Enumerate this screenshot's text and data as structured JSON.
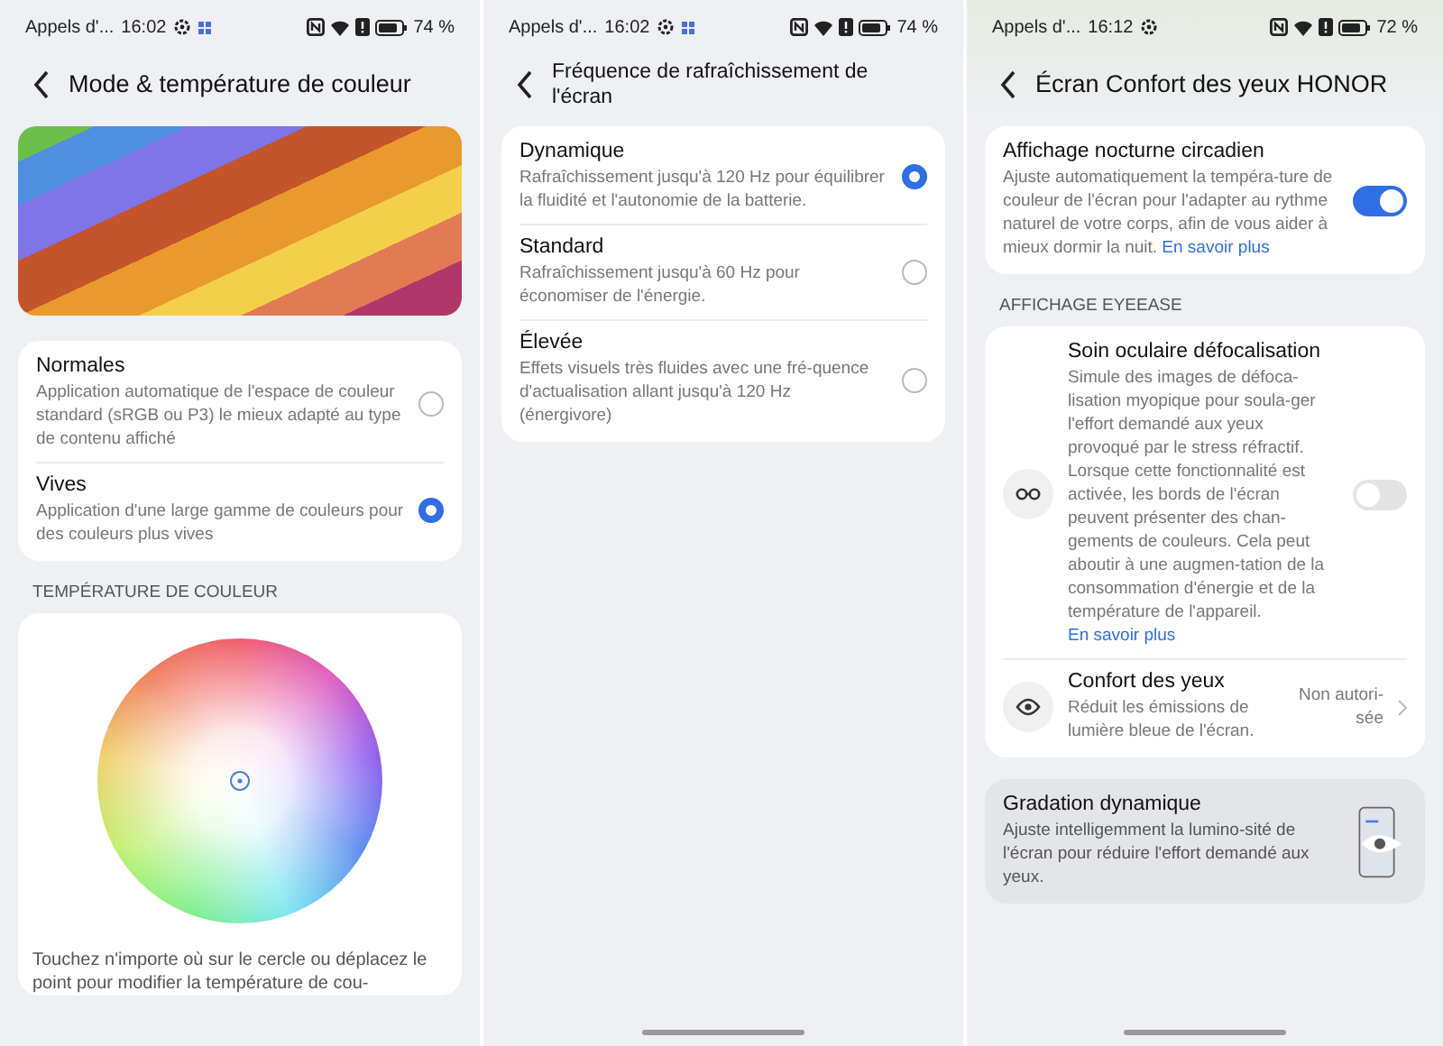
{
  "screens": [
    {
      "status": {
        "carrier": "Appels d'...",
        "time": "16:02",
        "battery": "74 %",
        "notification": true
      },
      "title": "Mode & température de couleur",
      "sections": [
        {
          "kind": "banner"
        },
        {
          "kind": "radio_card",
          "items": [
            {
              "title": "Normales",
              "description": "Application automatique de l'espace de couleur standard (sRGB ou P3) le mieux adapté au type de contenu affiché",
              "selected": false
            },
            {
              "title": "Vives",
              "description": "Application d'une large gamme de couleurs pour des couleurs plus vives",
              "selected": true
            }
          ]
        },
        {
          "kind": "heading",
          "text": "TEMPÉRATURE DE COULEUR"
        },
        {
          "kind": "color_wheel",
          "caption": "Touchez n'importe où sur le cercle ou déplacez le point pour modifier la température de cou-"
        }
      ]
    },
    {
      "status": {
        "carrier": "Appels d'...",
        "time": "16:02",
        "battery": "74 %",
        "notification": true
      },
      "title": "Fréquence de rafraîchissement de l'écran",
      "sections": [
        {
          "kind": "radio_card",
          "items": [
            {
              "title": "Dynamique",
              "description": "Rafraîchissement jusqu'à 120 Hz pour équilibrer la fluidité et l'autonomie de la batterie.",
              "selected": true
            },
            {
              "title": "Standard",
              "description": "Rafraîchissement jusqu'à 60 Hz pour économiser de l'énergie.",
              "selected": false
            },
            {
              "title": "Élevée",
              "description": "Effets visuels très fluides avec une fré-quence d'actualisation allant jusqu'à 120 Hz (énergivore)",
              "selected": false
            }
          ]
        }
      ]
    },
    {
      "status": {
        "carrier": "Appels d'...",
        "time": "16:12",
        "battery": "72 %",
        "notification": false
      },
      "title": "Écran Confort des yeux HONOR",
      "sections": [
        {
          "kind": "settings_card",
          "items": [
            {
              "kind": "toggle",
              "title": "Affichage nocturne circadien",
              "description": "Ajuste automatiquement la tempéra-ture de couleur de l'écran pour l'adapter au rythme naturel de votre corps, afin de vous aider à mieux dormir la nuit.",
              "link": "En savoir plus",
              "on": true
            }
          ]
        },
        {
          "kind": "heading",
          "text": "AFFICHAGE EYEEASE"
        },
        {
          "kind": "settings_card",
          "items": [
            {
              "kind": "icon_toggle",
              "title": "Soin oculaire défocalisation",
              "description": "Simule des images de défoca-lisation myopique pour soula-ger l'effort demandé aux yeux provoqué par le stress réfractif. Lorsque cette fonctionnalité est activée, les bords de l'écran peuvent présenter des chan-gements de couleurs. Cela peut aboutir à une augmen-tation de la consommation d'énergie et de la température de l'appareil.",
              "link": "En savoir plus",
              "on": false
            },
            {
              "kind": "icon_link",
              "title": "Confort des yeux",
              "description": "Réduit les émissions de lumière bleue de l'écran.",
              "value": "Non autori-sée"
            }
          ]
        },
        {
          "kind": "feature_card",
          "title": "Gradation dynamique",
          "description": "Ajuste intelligemment la lumino-sité de l'écran pour réduire l'effort demandé aux yeux."
        }
      ]
    }
  ]
}
